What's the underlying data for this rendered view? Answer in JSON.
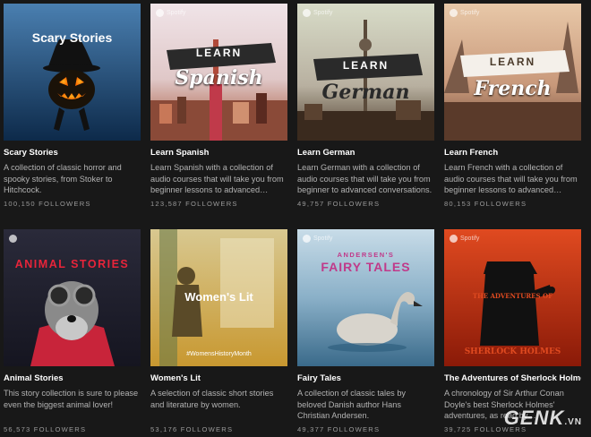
{
  "playlists": [
    {
      "cover_text": "Scary Stories",
      "title": "Scary Stories",
      "description": "A collection of classic horror and spooky stories, from Stoker to Hitchcock.",
      "followers": "100,150 FOLLOWERS",
      "cover_icon": "jack-o-lantern-icon",
      "colors": {
        "top": "#4a7fb0",
        "bottom": "#0d2a4a"
      }
    },
    {
      "badge": "Spotify",
      "banner_top": "LEARN",
      "banner_script": "Spanish",
      "title": "Learn Spanish",
      "description": "Learn Spanish with a collection of audio courses that will take you from beginner lessons to advanced…",
      "followers": "123,587 FOLLOWERS",
      "colors": {
        "top": "#f0e4e8",
        "bottom": "#a04a2a"
      }
    },
    {
      "badge": "Spotify",
      "banner_top": "LEARN",
      "banner_script": "German",
      "title": "Learn German",
      "description": "Learn German with a collection of audio courses that will take you from beginner to advanced conversations.",
      "followers": "49,757 FOLLOWERS",
      "colors": {
        "top": "#d8dcc8",
        "bottom": "#4a3a28"
      }
    },
    {
      "badge": "Spotify",
      "banner_top": "LEARN",
      "banner_script": "French",
      "title": "Learn French",
      "description": "Learn French with a collection of audio courses that will take you from beginner lessons to advanced…",
      "followers": "80,153 FOLLOWERS",
      "colors": {
        "top": "#e8c8a8",
        "bottom": "#6a4a38"
      }
    },
    {
      "badge": "Spotify",
      "cover_text": "ANIMAL STORIES",
      "title": "Animal Stories",
      "description": "This story collection is sure to please even the biggest animal lover!",
      "followers": "56,573 FOLLOWERS",
      "cover_icon": "dog-with-goggles-icon",
      "colors": {
        "top": "#2a2a3a",
        "bottom": "#151520",
        "accent": "#e0243a"
      }
    },
    {
      "cover_text": "Women's Lit",
      "cover_hashtag": "#WomensHistoryMonth",
      "title": "Women's Lit",
      "description": "A selection of classic short stories and literature by women.",
      "followers": "53,176 FOLLOWERS",
      "colors": {
        "top": "#d8c890",
        "bottom": "#c89830"
      }
    },
    {
      "cover_text_small": "ANDERSEN'S",
      "cover_text": "FAIRY TALES",
      "badge": "Spotify",
      "title": "Fairy Tales",
      "description": "A collection of classic tales by beloved Danish author Hans Christian Andersen.",
      "followers": "49,377 FOLLOWERS",
      "cover_icon": "swan-icon",
      "colors": {
        "top": "#a8c8d8",
        "bottom": "#3a6a8a",
        "accent": "#c03a8a"
      }
    },
    {
      "badge": "Spotify",
      "cover_text_top": "THE ADVENTURES OF",
      "cover_text": "SHERLOCK HOLMES",
      "title": "The Adventures of Sherlock Holmes",
      "description": "A chronology of Sir Arthur Conan Doyle's best Sherlock Holmes' adventures, as read by…",
      "followers": "39,725 FOLLOWERS",
      "cover_icon": "sherlock-silhouette-icon",
      "colors": {
        "top": "#e04a20",
        "bottom": "#8a1a08"
      }
    }
  ],
  "watermark": {
    "text": "GENK",
    "suffix": ".VN"
  }
}
